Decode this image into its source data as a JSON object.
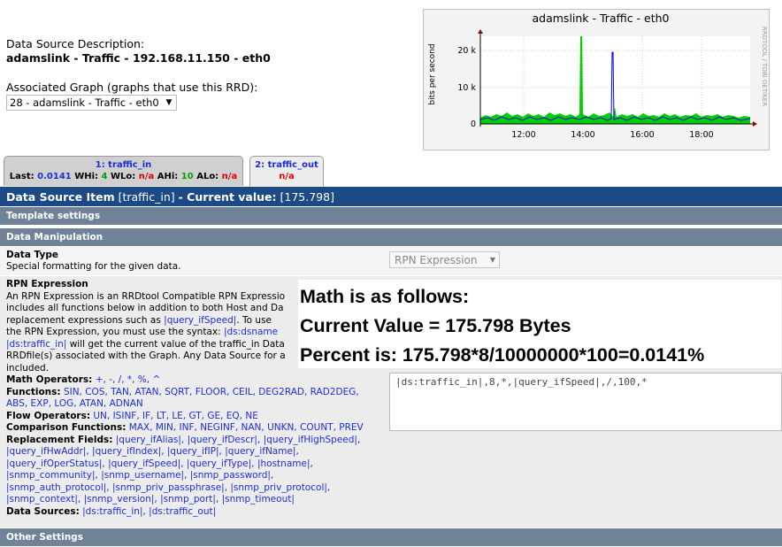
{
  "data_source": {
    "description_label": "Data Source Description:",
    "description_value": "adamslink - Traffic - 192.168.11.150 - eth0",
    "assoc_label": "Associated Graph (graphs that use this RRD):",
    "assoc_selected": "28 - adamslink - Traffic - eth0"
  },
  "graph": {
    "title": "adamslink - Traffic - eth0",
    "ylabel": "bits per second",
    "side_label": "RRDTOOL / TOBI OETIKER",
    "y_ticks": [
      "20 k",
      "10 k",
      "0"
    ],
    "x_ticks": [
      "12:00",
      "14:00",
      "16:00",
      "18:00"
    ],
    "colors": {
      "in": "#00cf00",
      "out": "#0000ff",
      "bg": "#ffffff",
      "grid": "#ffbfbf"
    }
  },
  "tabs": [
    {
      "label": "1: traffic_in",
      "last_label": "Last:",
      "last": "0.0141",
      "whi_label": "WHi:",
      "whi": "4",
      "wlo_label": "WLo:",
      "wlo": "n/a",
      "ahi_label": "AHi:",
      "ahi": "10",
      "alo_label": "ALo:",
      "alo": "n/a"
    },
    {
      "label": "2: traffic_out",
      "value": "n/a"
    }
  ],
  "item_header": {
    "prefix": "Data Source Item",
    "name": "[traffic_in]",
    "current_label": "- Current value:",
    "current_value": "[175.798]"
  },
  "sections": {
    "template": "Template settings",
    "manipulation": "Data Manipulation",
    "other": "Other Settings"
  },
  "data_type": {
    "label": "Data Type",
    "desc": "Special formatting for the given data.",
    "selected": "RPN Expression"
  },
  "rpn": {
    "title": "RPN Expression",
    "desc1": "An RPN Expression is an RRDtool Compatible RPN Expressio",
    "desc2": "includes all functions below in addition to both Host and Da",
    "desc3a": "replacement expressions such as ",
    "desc3b": "|query_ifSpeed|",
    "desc3c": ". To use",
    "desc4a": "the RPN Expression, you must use the syntax: ",
    "desc4b": "|ds:dsname",
    "desc5a": "|ds:traffic_in|",
    "desc5b": " will get the current value of the traffic_in Data",
    "desc6": "RRDfile(s) associated with the Graph. Any Data Source for a",
    "desc7": "included.",
    "math_label": "Math Operators:",
    "math": "+, -, /, *, %, ^",
    "func_label": "Functions:",
    "func1": "SIN, COS, TAN, ATAN, SQRT, FLOOR, CEIL, DEG2RAD, RAD2DEG,",
    "func2": "ABS, EXP, LOG, ATAN, ADNAN",
    "flow_label": "Flow Operators:",
    "flow": "UN, ISINF, IF, LT, LE, GT, GE, EQ, NE",
    "comp_label": "Comparison Functions:",
    "comp": "MAX, MIN, INF, NEGINF, NAN, UNKN, COUNT, PREV",
    "repl_label": "Replacement Fields:",
    "repl1": "|query_ifAlias|, |query_ifDescr|, |query_ifHighSpeed|,",
    "repl2": "|query_ifHwAddr|, |query_ifIndex|, |query_ifIP|, |query_ifName|,",
    "repl3": "|query_ifOperStatus|, |query_ifSpeed|, |query_ifType|, |hostname|,",
    "repl4": "|snmp_community|, |snmp_username|, |snmp_password|,",
    "repl5": "|snmp_auth_protocol|, |snmp_priv_passphrase|, |snmp_priv_protocol|,",
    "repl6": "|snmp_context|, |snmp_version|, |snmp_port|, |snmp_timeout|",
    "ds_label": "Data Sources:",
    "ds": "|ds:traffic_in|, |ds:traffic_out|",
    "expression": "|ds:traffic_in|,8,*,|query_ifSpeed|,/,100,*"
  },
  "overlay": {
    "line1": "Math is as follows:",
    "line2": "Current Value = 175.798 Bytes",
    "line3": "Percent is:  175.798*8/10000000*100=0.0141%"
  }
}
